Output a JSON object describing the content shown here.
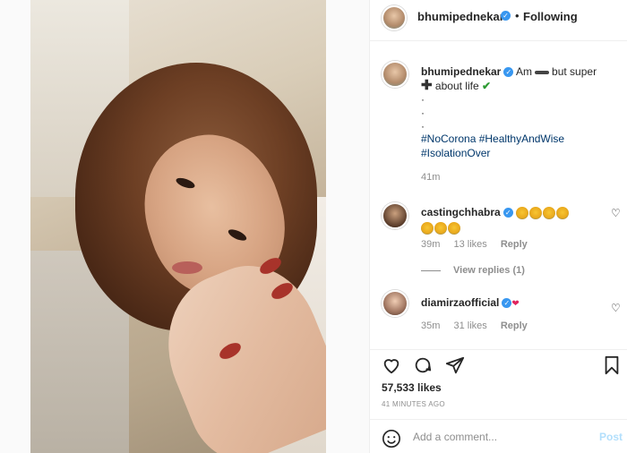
{
  "header": {
    "username": "bhumipednekar",
    "follow_status": "Following"
  },
  "caption": {
    "username": "bhumipednekar",
    "text_part1": "Am",
    "text_part2": "but super",
    "text_part3": "about life",
    "dots": [
      "·",
      "·",
      "·"
    ],
    "hashtags": [
      "#NoCorona",
      "#HealthyAndWise",
      "#IsolationOver"
    ],
    "time": "41m"
  },
  "comments": [
    {
      "username": "castingchhabra",
      "emoji_count": 7,
      "time": "39m",
      "likes": "13 likes",
      "reply": "Reply"
    },
    {
      "username": "diamirzaofficial",
      "time": "35m",
      "likes": "31 likes",
      "reply": "Reply"
    }
  ],
  "view_replies": "View replies (1)",
  "likes_count": "57,533 likes",
  "post_time": "41 MINUTES AGO",
  "add_comment": {
    "placeholder": "Add a comment...",
    "post_label": "Post"
  },
  "colors": {
    "verified": "#3897f0",
    "hashtag": "#00376b",
    "muted": "#8e8e8e",
    "post_disabled": "#b2dffc"
  }
}
